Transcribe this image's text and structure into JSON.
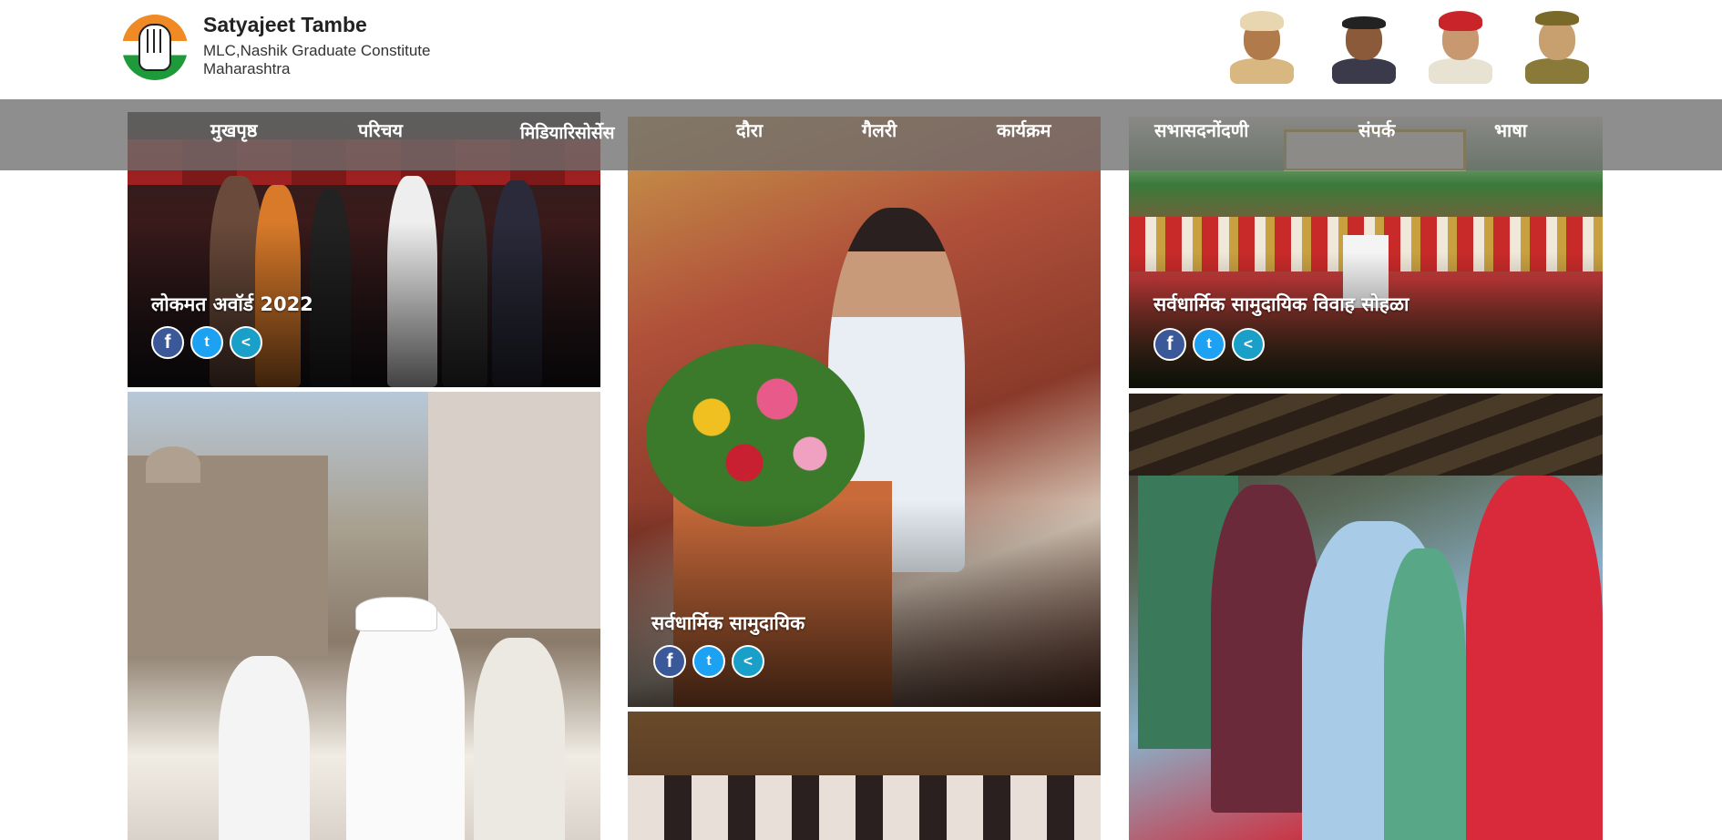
{
  "header": {
    "name": "Satyajeet Tambe",
    "subtitle_line1": "MLC,Nashik Graduate Constitute",
    "subtitle_line2": "Maharashtra"
  },
  "nav": {
    "items": [
      "मुखपृष्ठ",
      "परिचय",
      "मिडियारिसोर्सेस",
      "दौरा",
      "गैलरी",
      "कार्यक्रम",
      "सभासदनोंदणी",
      "संपर्क",
      "भाषा"
    ]
  },
  "gallery": {
    "tiles": [
      {
        "caption": "लोकमत अवॉर्ड 2022"
      },
      {
        "caption": "सर्वधार्मिक सामुदायिक"
      },
      {
        "caption": "सर्वधार्मिक सामुदायिक विवाह सोहळा"
      }
    ],
    "share_icons": {
      "facebook": "f",
      "twitter": "t",
      "share": "<"
    }
  },
  "colors": {
    "nav_overlay": "#6e6e6e",
    "facebook": "#3b5998",
    "twitter": "#1da1f2",
    "share": "#1aa0c8",
    "logo_saffron": "#f08a24",
    "logo_green": "#1f9a3a"
  }
}
